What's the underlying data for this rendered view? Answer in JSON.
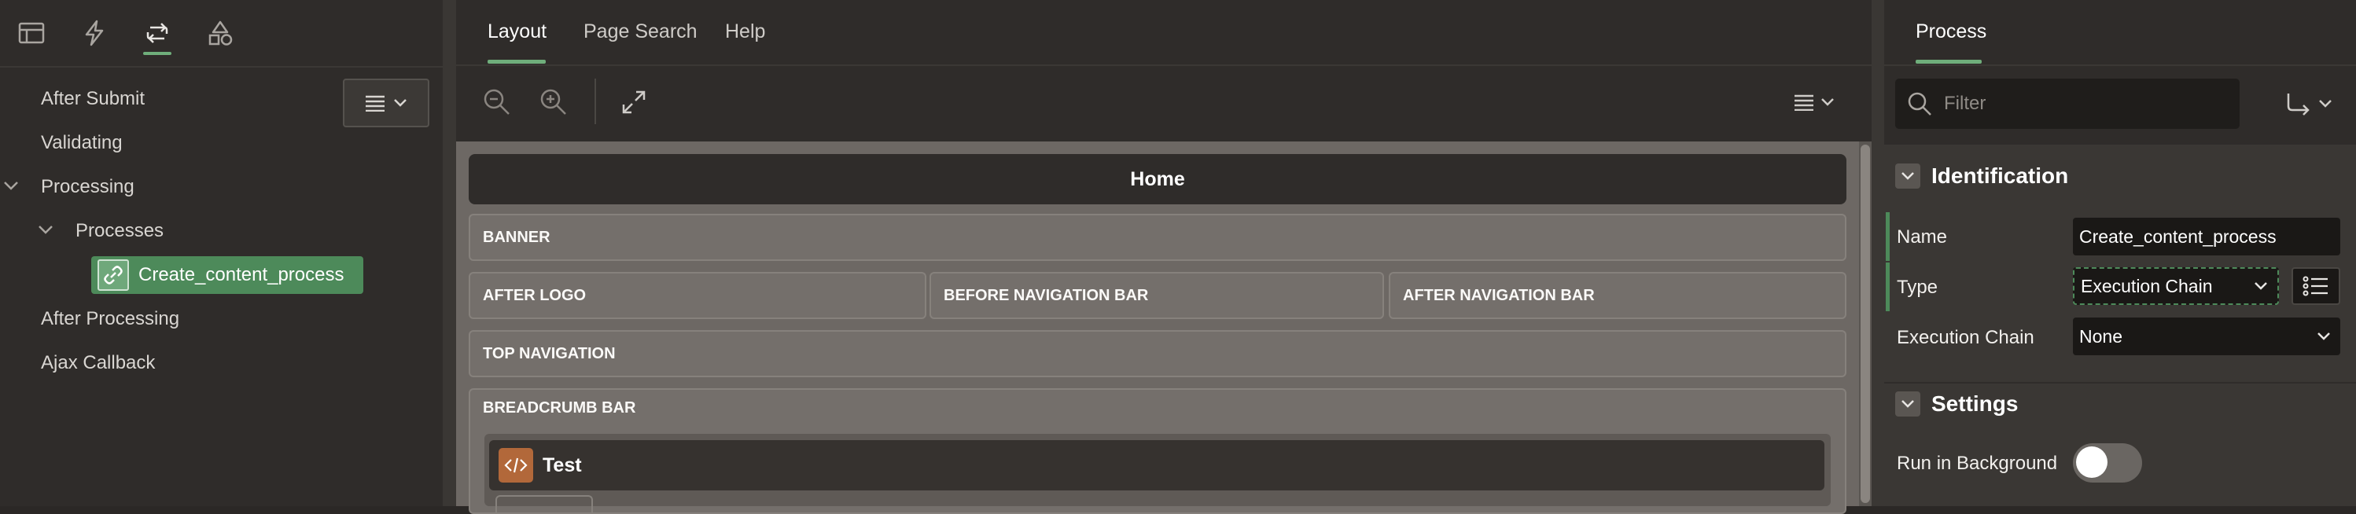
{
  "left_panel": {
    "tabs": [
      {
        "icon": "rendering-tree-icon"
      },
      {
        "icon": "dynamic-actions-icon"
      },
      {
        "icon": "processing-icon",
        "active": true
      },
      {
        "icon": "shared-components-icon"
      }
    ],
    "tree": {
      "after_submit": "After Submit",
      "validating": "Validating",
      "processing": "Processing",
      "processes": "Processes",
      "selected_process": "Create_content_process",
      "after_processing": "After Processing",
      "ajax_callback": "Ajax Callback"
    }
  },
  "center_panel": {
    "tabs": {
      "layout": "Layout",
      "page_search": "Page Search",
      "help": "Help"
    },
    "page_name": "Home",
    "regions": {
      "banner": "BANNER",
      "after_logo": "AFTER LOGO",
      "before_navigation_bar": "BEFORE NAVIGATION BAR",
      "after_navigation_bar": "AFTER NAVIGATION BAR",
      "top_navigation": "TOP NAVIGATION",
      "breadcrumb_bar": "BREADCRUMB BAR"
    },
    "component": {
      "icon": "code-icon",
      "label": "Test"
    }
  },
  "right_panel": {
    "tab": "Process",
    "filter_placeholder": "Filter",
    "groups": {
      "identification": "Identification",
      "settings": "Settings"
    },
    "properties": {
      "name_label": "Name",
      "name_value": "Create_content_process",
      "type_label": "Type",
      "type_value": "Execution Chain",
      "execution_chain_label": "Execution Chain",
      "execution_chain_value": "None",
      "run_in_background_label": "Run in Background",
      "run_in_background": false
    }
  },
  "colors": {
    "accent": "#6fae7b",
    "selected_node": "#4d8a5a",
    "component_icon": "#b2683a",
    "canvas": "#6d6864"
  }
}
